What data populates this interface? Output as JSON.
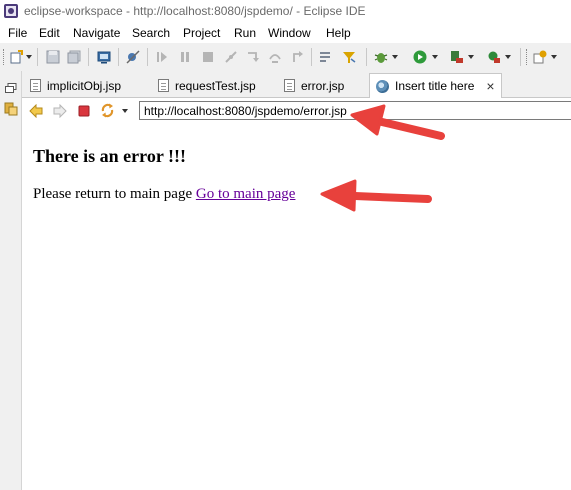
{
  "window": {
    "title": "eclipse-workspace - http://localhost:8080/jspdemo/ - Eclipse IDE",
    "icon": "eclipse-icon"
  },
  "menu": [
    "File",
    "Edit",
    "Navigate",
    "Search",
    "Project",
    "Run",
    "Window",
    "Help"
  ],
  "tabs": [
    {
      "label": "implicitObj.jsp",
      "icon": "jsp-file-icon",
      "active": false
    },
    {
      "label": "requestTest.jsp",
      "icon": "jsp-file-icon",
      "active": false
    },
    {
      "label": "error.jsp",
      "icon": "jsp-file-icon",
      "active": false
    },
    {
      "label": "Insert title here",
      "icon": "globe-icon",
      "active": true,
      "close": "×"
    }
  ],
  "browser": {
    "url": "http://localhost:8080/jspdemo/error.jsp"
  },
  "page": {
    "heading": "There is an error !!!",
    "message": "Please return to main page",
    "link_text": "Go to main page"
  },
  "colors": {
    "annotation_arrow": "#e8413c",
    "visited_link": "#660099"
  }
}
